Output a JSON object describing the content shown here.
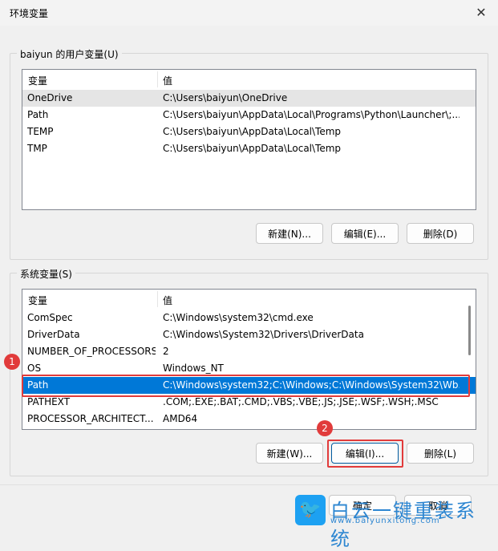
{
  "window": {
    "title": "环境变量",
    "close_label": "✕"
  },
  "user_vars": {
    "group_label": "baiyun 的用户变量(U)",
    "col_name": "变量",
    "col_value": "值",
    "rows": [
      {
        "name": "OneDrive",
        "value": "C:\\Users\\baiyun\\OneDrive"
      },
      {
        "name": "Path",
        "value": "C:\\Users\\baiyun\\AppData\\Local\\Programs\\Python\\Launcher\\;..."
      },
      {
        "name": "TEMP",
        "value": "C:\\Users\\baiyun\\AppData\\Local\\Temp"
      },
      {
        "name": "TMP",
        "value": "C:\\Users\\baiyun\\AppData\\Local\\Temp"
      }
    ],
    "buttons": {
      "new": "新建(N)...",
      "edit": "编辑(E)...",
      "delete": "删除(D)"
    }
  },
  "system_vars": {
    "group_label": "系统变量(S)",
    "col_name": "变量",
    "col_value": "值",
    "rows": [
      {
        "name": "ComSpec",
        "value": "C:\\Windows\\system32\\cmd.exe"
      },
      {
        "name": "DriverData",
        "value": "C:\\Windows\\System32\\Drivers\\DriverData"
      },
      {
        "name": "NUMBER_OF_PROCESSORS",
        "value": "2"
      },
      {
        "name": "OS",
        "value": "Windows_NT"
      },
      {
        "name": "Path",
        "value": "C:\\Windows\\system32;C:\\Windows;C:\\Windows\\System32\\Wb..."
      },
      {
        "name": "PATHEXT",
        "value": ".COM;.EXE;.BAT;.CMD;.VBS;.VBE;.JS;.JSE;.WSF;.WSH;.MSC"
      },
      {
        "name": "PROCESSOR_ARCHITECT...",
        "value": "AMD64"
      }
    ],
    "buttons": {
      "new": "新建(W)...",
      "edit": "编辑(I)...",
      "delete": "删除(L)"
    }
  },
  "footer": {
    "ok": "确定",
    "cancel": "取消"
  },
  "annotations": {
    "badge1": "1",
    "badge2": "2"
  },
  "watermark": {
    "text": "白云一键重装系统",
    "url": "www.baiyunxitong.com"
  },
  "colors": {
    "selection": "#0078d7",
    "annotation": "#e13b3b",
    "watermark": "#2d86d1"
  }
}
